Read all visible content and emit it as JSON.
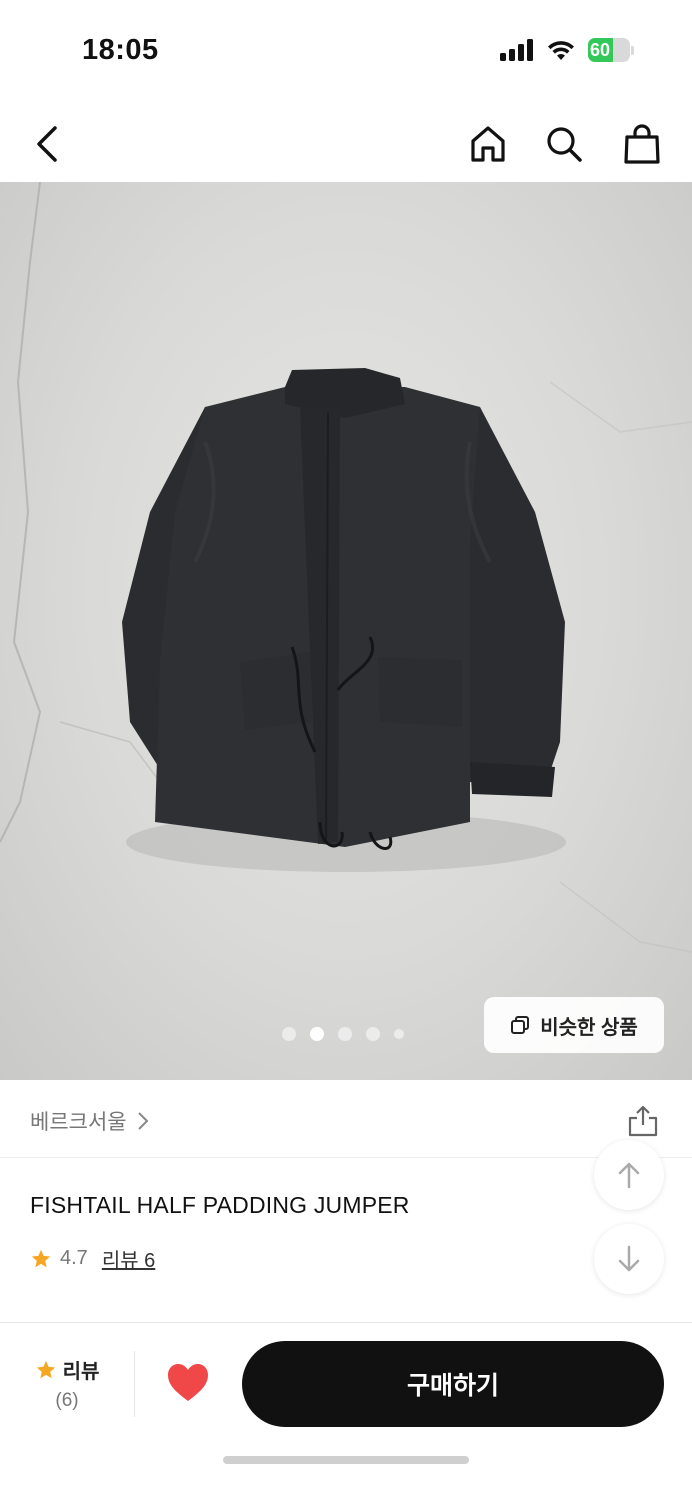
{
  "status_bar": {
    "time": "18:05",
    "battery_percent": "60",
    "battery_level": 0.6
  },
  "nav": {
    "icons": [
      "chevron-left-icon",
      "home-icon",
      "search-icon",
      "shopping-bag-icon"
    ]
  },
  "hero": {
    "image_desc": "black fishtail padded jumper",
    "page_count": 5,
    "active_page": 2,
    "similar_label": "비슷한 상품"
  },
  "seller": {
    "name": "베르크서울"
  },
  "product": {
    "title": "FISHTAIL HALF PADDING JUMPER",
    "rating": "4.7",
    "review_link": "리뷰 6"
  },
  "bottom_bar": {
    "review_label": "리뷰",
    "review_count": "(6)",
    "buy_label": "구매하기"
  },
  "colors": {
    "accent_star": "#f5a623",
    "heart": "#f04848",
    "buy_button": "#111111"
  }
}
